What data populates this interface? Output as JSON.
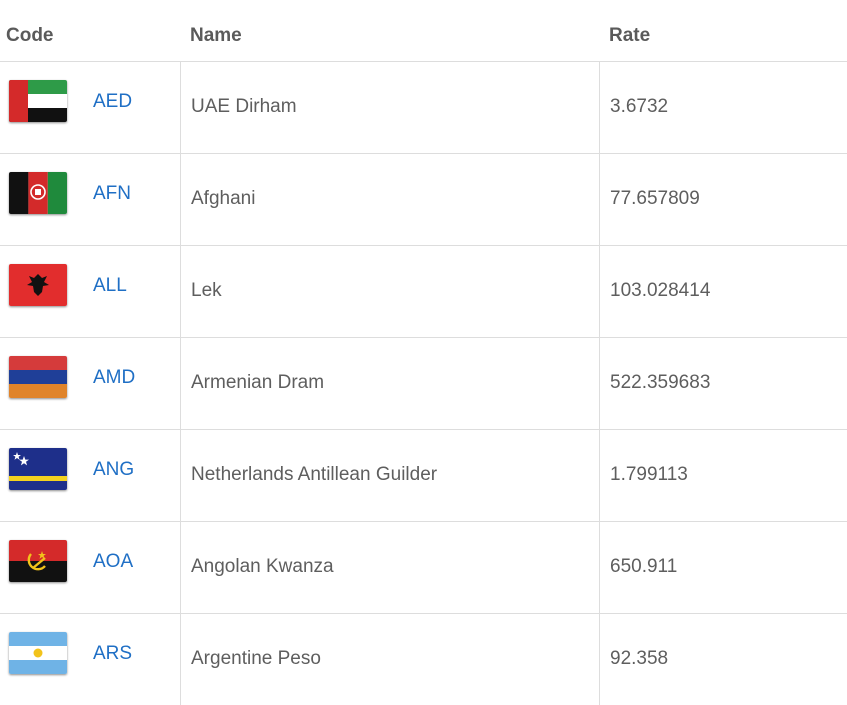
{
  "header": {
    "code": "Code",
    "name": "Name",
    "rate": "Rate"
  },
  "rows": [
    {
      "code": "AED",
      "name": "UAE Dirham",
      "rate": "3.6732",
      "flag": "uae-flag-icon"
    },
    {
      "code": "AFN",
      "name": "Afghani",
      "rate": "77.657809",
      "flag": "afghanistan-flag-icon"
    },
    {
      "code": "ALL",
      "name": "Lek",
      "rate": "103.028414",
      "flag": "albania-flag-icon"
    },
    {
      "code": "AMD",
      "name": "Armenian Dram",
      "rate": "522.359683",
      "flag": "armenia-flag-icon"
    },
    {
      "code": "ANG",
      "name": "Netherlands Antillean Guilder",
      "rate": "1.799113",
      "flag": "curacao-flag-icon"
    },
    {
      "code": "AOA",
      "name": "Angolan Kwanza",
      "rate": "650.911",
      "flag": "angola-flag-icon"
    },
    {
      "code": "ARS",
      "name": "Argentine Peso",
      "rate": "92.358",
      "flag": "argentina-flag-icon"
    }
  ],
  "colors": {
    "link": "#1f6fc5",
    "text": "#5e5e5e",
    "header_text": "#5a5a5a",
    "border": "#dddddd"
  }
}
